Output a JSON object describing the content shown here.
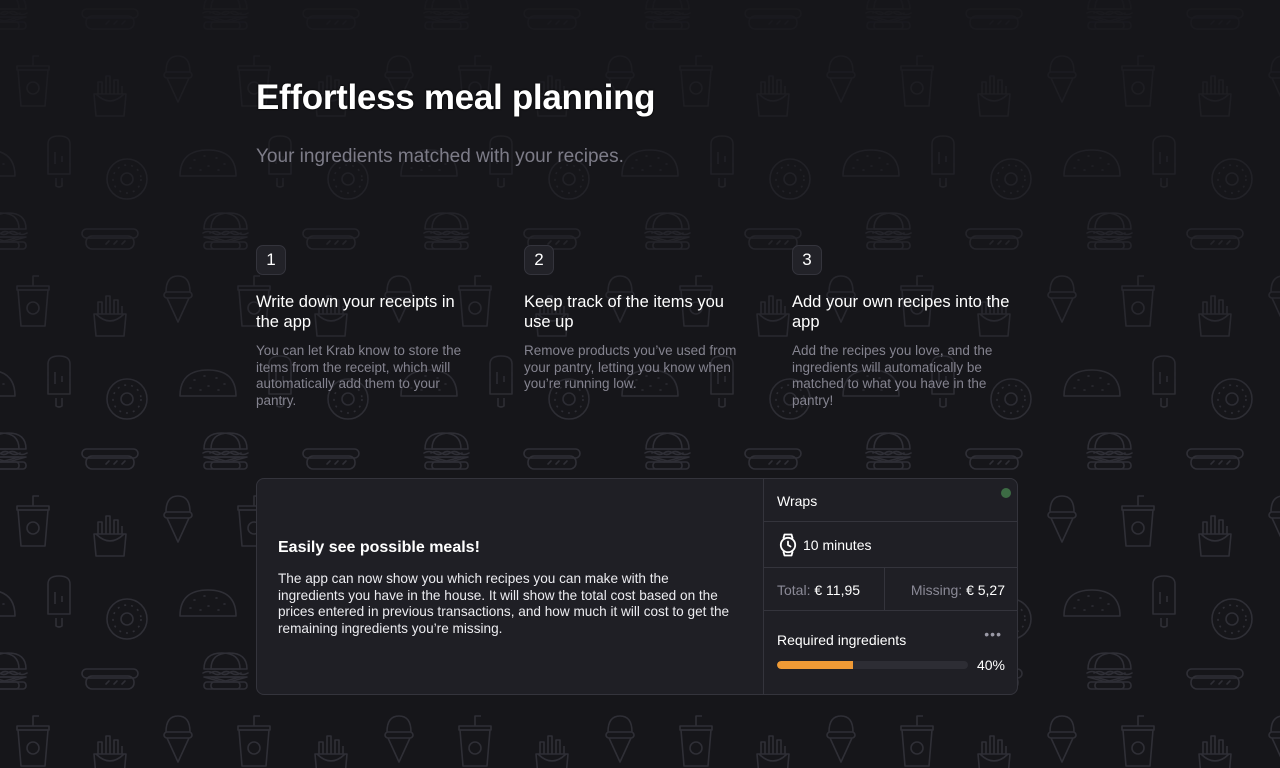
{
  "hero": {
    "title": "Effortless meal planning",
    "subtitle": "Your ingredients matched with your recipes."
  },
  "steps": [
    {
      "number": "1",
      "title": "Write down your receipts in the app",
      "description": "You can let Krab know to store the items from the receipt, which will automatically add them to your pantry."
    },
    {
      "number": "2",
      "title": "Keep track of the items you use up",
      "description": "Remove products you’ve used from your pantry, letting you know when you’re running low."
    },
    {
      "number": "3",
      "title": "Add your own recipes into the app",
      "description": "Add the recipes you love, and the ingredients will automatically be matched to what you have in the pantry!"
    }
  ],
  "feature": {
    "heading": "Easily see possible meals!",
    "text": "The app can now show you which recipes you can make with the ingredients you have in the house. It will show the total cost based on the prices entered in previous transactions, and how much it will cost to get the remaining ingredients you’re missing."
  },
  "recipe_card": {
    "name": "Wraps",
    "status_color": "#3c6b44",
    "time_icon": "watch-icon",
    "time": "10 minutes",
    "total_label": "Total:",
    "total_value": "€ 11,95",
    "missing_label": "Missing:",
    "missing_value": "€ 5,27",
    "required_label": "Required ingredients",
    "more_label": "•••",
    "progress_percent": 40,
    "progress_text": "40%",
    "progress_color": "#f09a35"
  },
  "background": {
    "pattern_icons": [
      "burger-icon",
      "hotdog-icon",
      "soda-cup-icon",
      "fries-icon",
      "ice-cream-cone-icon",
      "popsicle-icon",
      "donut-icon",
      "taco-icon"
    ]
  }
}
